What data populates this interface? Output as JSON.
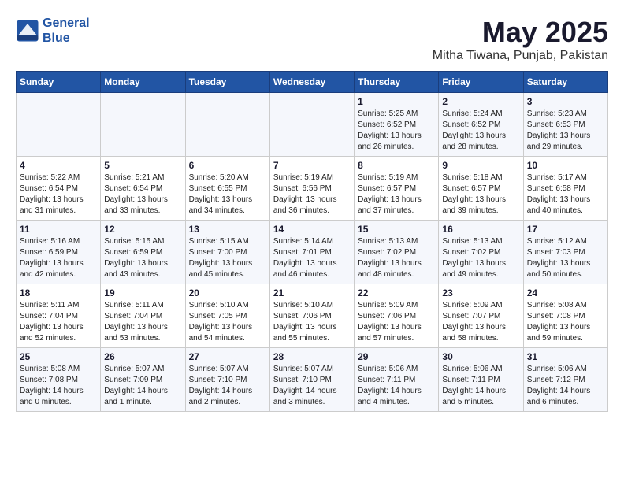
{
  "logo": {
    "line1": "General",
    "line2": "Blue"
  },
  "title": "May 2025",
  "subtitle": "Mitha Tiwana, Punjab, Pakistan",
  "days_of_week": [
    "Sunday",
    "Monday",
    "Tuesday",
    "Wednesday",
    "Thursday",
    "Friday",
    "Saturday"
  ],
  "weeks": [
    [
      {
        "day": "",
        "info": ""
      },
      {
        "day": "",
        "info": ""
      },
      {
        "day": "",
        "info": ""
      },
      {
        "day": "",
        "info": ""
      },
      {
        "day": "1",
        "info": "Sunrise: 5:25 AM\nSunset: 6:52 PM\nDaylight: 13 hours\nand 26 minutes."
      },
      {
        "day": "2",
        "info": "Sunrise: 5:24 AM\nSunset: 6:52 PM\nDaylight: 13 hours\nand 28 minutes."
      },
      {
        "day": "3",
        "info": "Sunrise: 5:23 AM\nSunset: 6:53 PM\nDaylight: 13 hours\nand 29 minutes."
      }
    ],
    [
      {
        "day": "4",
        "info": "Sunrise: 5:22 AM\nSunset: 6:54 PM\nDaylight: 13 hours\nand 31 minutes."
      },
      {
        "day": "5",
        "info": "Sunrise: 5:21 AM\nSunset: 6:54 PM\nDaylight: 13 hours\nand 33 minutes."
      },
      {
        "day": "6",
        "info": "Sunrise: 5:20 AM\nSunset: 6:55 PM\nDaylight: 13 hours\nand 34 minutes."
      },
      {
        "day": "7",
        "info": "Sunrise: 5:19 AM\nSunset: 6:56 PM\nDaylight: 13 hours\nand 36 minutes."
      },
      {
        "day": "8",
        "info": "Sunrise: 5:19 AM\nSunset: 6:57 PM\nDaylight: 13 hours\nand 37 minutes."
      },
      {
        "day": "9",
        "info": "Sunrise: 5:18 AM\nSunset: 6:57 PM\nDaylight: 13 hours\nand 39 minutes."
      },
      {
        "day": "10",
        "info": "Sunrise: 5:17 AM\nSunset: 6:58 PM\nDaylight: 13 hours\nand 40 minutes."
      }
    ],
    [
      {
        "day": "11",
        "info": "Sunrise: 5:16 AM\nSunset: 6:59 PM\nDaylight: 13 hours\nand 42 minutes."
      },
      {
        "day": "12",
        "info": "Sunrise: 5:15 AM\nSunset: 6:59 PM\nDaylight: 13 hours\nand 43 minutes."
      },
      {
        "day": "13",
        "info": "Sunrise: 5:15 AM\nSunset: 7:00 PM\nDaylight: 13 hours\nand 45 minutes."
      },
      {
        "day": "14",
        "info": "Sunrise: 5:14 AM\nSunset: 7:01 PM\nDaylight: 13 hours\nand 46 minutes."
      },
      {
        "day": "15",
        "info": "Sunrise: 5:13 AM\nSunset: 7:02 PM\nDaylight: 13 hours\nand 48 minutes."
      },
      {
        "day": "16",
        "info": "Sunrise: 5:13 AM\nSunset: 7:02 PM\nDaylight: 13 hours\nand 49 minutes."
      },
      {
        "day": "17",
        "info": "Sunrise: 5:12 AM\nSunset: 7:03 PM\nDaylight: 13 hours\nand 50 minutes."
      }
    ],
    [
      {
        "day": "18",
        "info": "Sunrise: 5:11 AM\nSunset: 7:04 PM\nDaylight: 13 hours\nand 52 minutes."
      },
      {
        "day": "19",
        "info": "Sunrise: 5:11 AM\nSunset: 7:04 PM\nDaylight: 13 hours\nand 53 minutes."
      },
      {
        "day": "20",
        "info": "Sunrise: 5:10 AM\nSunset: 7:05 PM\nDaylight: 13 hours\nand 54 minutes."
      },
      {
        "day": "21",
        "info": "Sunrise: 5:10 AM\nSunset: 7:06 PM\nDaylight: 13 hours\nand 55 minutes."
      },
      {
        "day": "22",
        "info": "Sunrise: 5:09 AM\nSunset: 7:06 PM\nDaylight: 13 hours\nand 57 minutes."
      },
      {
        "day": "23",
        "info": "Sunrise: 5:09 AM\nSunset: 7:07 PM\nDaylight: 13 hours\nand 58 minutes."
      },
      {
        "day": "24",
        "info": "Sunrise: 5:08 AM\nSunset: 7:08 PM\nDaylight: 13 hours\nand 59 minutes."
      }
    ],
    [
      {
        "day": "25",
        "info": "Sunrise: 5:08 AM\nSunset: 7:08 PM\nDaylight: 14 hours\nand 0 minutes."
      },
      {
        "day": "26",
        "info": "Sunrise: 5:07 AM\nSunset: 7:09 PM\nDaylight: 14 hours\nand 1 minute."
      },
      {
        "day": "27",
        "info": "Sunrise: 5:07 AM\nSunset: 7:10 PM\nDaylight: 14 hours\nand 2 minutes."
      },
      {
        "day": "28",
        "info": "Sunrise: 5:07 AM\nSunset: 7:10 PM\nDaylight: 14 hours\nand 3 minutes."
      },
      {
        "day": "29",
        "info": "Sunrise: 5:06 AM\nSunset: 7:11 PM\nDaylight: 14 hours\nand 4 minutes."
      },
      {
        "day": "30",
        "info": "Sunrise: 5:06 AM\nSunset: 7:11 PM\nDaylight: 14 hours\nand 5 minutes."
      },
      {
        "day": "31",
        "info": "Sunrise: 5:06 AM\nSunset: 7:12 PM\nDaylight: 14 hours\nand 6 minutes."
      }
    ]
  ]
}
